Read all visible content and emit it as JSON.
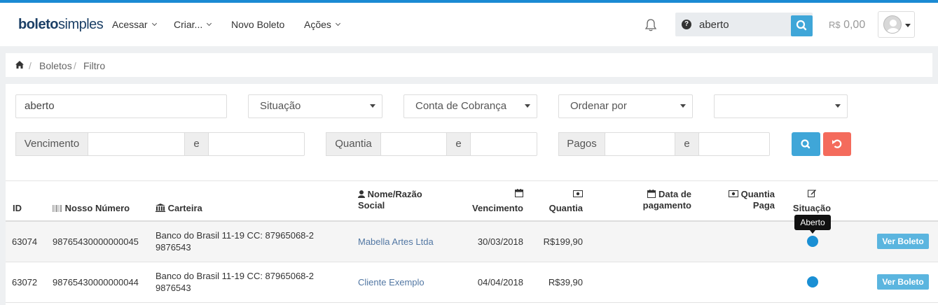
{
  "brand": {
    "part1": "boleto",
    "part2": "simples",
    "accent": "#1b8ad3"
  },
  "nav": {
    "acessar": "Acessar",
    "criar": "Criar...",
    "novo_boleto": "Novo Boleto",
    "acoes": "Ações"
  },
  "search": {
    "value": "aberto",
    "help_icon": "question-circle-icon"
  },
  "saldo": {
    "currency": "R$",
    "amount": "0,00"
  },
  "breadcrumb": [
    "Boletos",
    "Filtro"
  ],
  "filters": {
    "query": "aberto",
    "situacao": "Situação",
    "conta": "Conta de Cobrança",
    "ordenar": "Ordenar por",
    "extra": "",
    "vencimento_label": "Vencimento",
    "quantia_label": "Quantia",
    "pagos_label": "Pagos",
    "and_label": "e"
  },
  "table": {
    "headers": {
      "id": "ID",
      "nosso_numero": "Nosso Número",
      "carteira": "Carteira",
      "nome_1": "Nome/Razão",
      "nome_2": "Social",
      "vencimento": "Vencimento",
      "quantia": "Quantia",
      "data_1": "Data de",
      "data_2": "pagamento",
      "qpaga_1": "Quantia",
      "qpaga_2": "Paga",
      "situacao": "Situação"
    },
    "rows": [
      {
        "id": "63074",
        "nosso_numero": "98765430000000045",
        "carteira_1": "Banco do Brasil 11-19 CC: 87965068-2",
        "carteira_2": "9876543",
        "nome": "Mabella Artes Ltda",
        "vencimento": "30/03/2018",
        "quantia": "R$199,90",
        "data_pagamento": "",
        "quantia_paga": "",
        "status": "Aberto",
        "action": "Ver Boleto"
      },
      {
        "id": "63072",
        "nosso_numero": "98765430000000044",
        "carteira_1": "Banco do Brasil 11-19 CC: 87965068-2",
        "carteira_2": "9876543",
        "nome": "Cliente Exemplo",
        "vencimento": "04/04/2018",
        "quantia": "R$39,90",
        "data_pagamento": "",
        "quantia_paga": "",
        "status": "Aberto",
        "action": "Ver Boleto"
      }
    ]
  },
  "tooltip": "Aberto",
  "colors": {
    "primary": "#3fa6d8",
    "danger": "#f46b5c",
    "status_aberto": "#1a8fd4"
  }
}
